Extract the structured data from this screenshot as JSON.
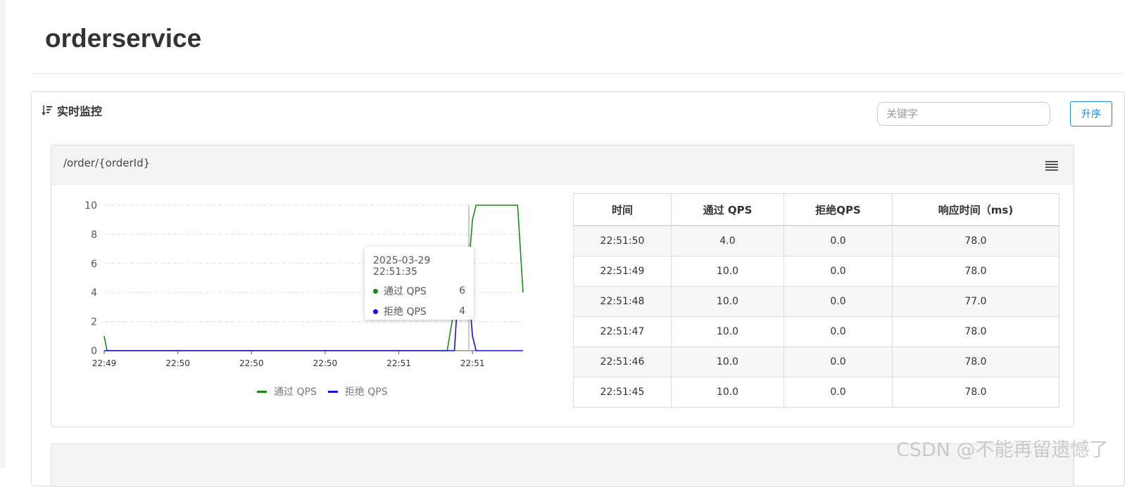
{
  "page": {
    "title": "orderservice"
  },
  "panel": {
    "heading": "实时监控",
    "search_placeholder": "关键字",
    "sort_button_label": "升序"
  },
  "resource": {
    "name": "/order/{orderId}",
    "menu_icon": "menu-icon"
  },
  "tooltip": {
    "time": "2025-03-29 22:51:35",
    "rows": [
      {
        "name": "通过 QPS",
        "value": "6",
        "color": "#1a8a1a"
      },
      {
        "name": "拒绝 QPS",
        "value": "4",
        "color": "#1010e0"
      }
    ]
  },
  "chart_data": {
    "type": "line",
    "x_ticks": [
      "22:49",
      "22:50",
      "22:50",
      "22:50",
      "22:51",
      "22:51"
    ],
    "y_ticks": [
      "0",
      "2",
      "4",
      "6",
      "8",
      "10"
    ],
    "ylim": [
      0,
      10
    ],
    "grid": true,
    "legend_position": "bottom",
    "series": [
      {
        "name": "通过 QPS",
        "color": "#1a8a1a",
        "points": [
          [
            0,
            1
          ],
          [
            0.8,
            0
          ],
          [
            95,
            0
          ],
          [
            97,
            3
          ],
          [
            99,
            3
          ],
          [
            101,
            6
          ],
          [
            102,
            9
          ],
          [
            103,
            10
          ],
          [
            114,
            10
          ],
          [
            114.5,
            10
          ],
          [
            116,
            4
          ]
        ]
      },
      {
        "name": "拒绝 QPS",
        "color": "#1010e0",
        "points": [
          [
            0,
            0
          ],
          [
            97,
            0
          ],
          [
            98,
            4
          ],
          [
            99,
            7
          ],
          [
            100,
            6.5
          ],
          [
            101,
            4
          ],
          [
            102,
            1
          ],
          [
            103,
            0
          ],
          [
            116,
            0
          ]
        ]
      }
    ],
    "cursor_x": 101
  },
  "table": {
    "headers": [
      "时间",
      "通过 QPS",
      "拒绝QPS",
      "响应时间（ms)"
    ],
    "rows": [
      [
        "22:51:50",
        "4.0",
        "0.0",
        "78.0"
      ],
      [
        "22:51:49",
        "10.0",
        "0.0",
        "78.0"
      ],
      [
        "22:51:48",
        "10.0",
        "0.0",
        "77.0"
      ],
      [
        "22:51:47",
        "10.0",
        "0.0",
        "78.0"
      ],
      [
        "22:51:46",
        "10.0",
        "0.0",
        "78.0"
      ],
      [
        "22:51:45",
        "10.0",
        "0.0",
        "78.0"
      ]
    ]
  },
  "watermark": "CSDN @不能再留遗憾了"
}
